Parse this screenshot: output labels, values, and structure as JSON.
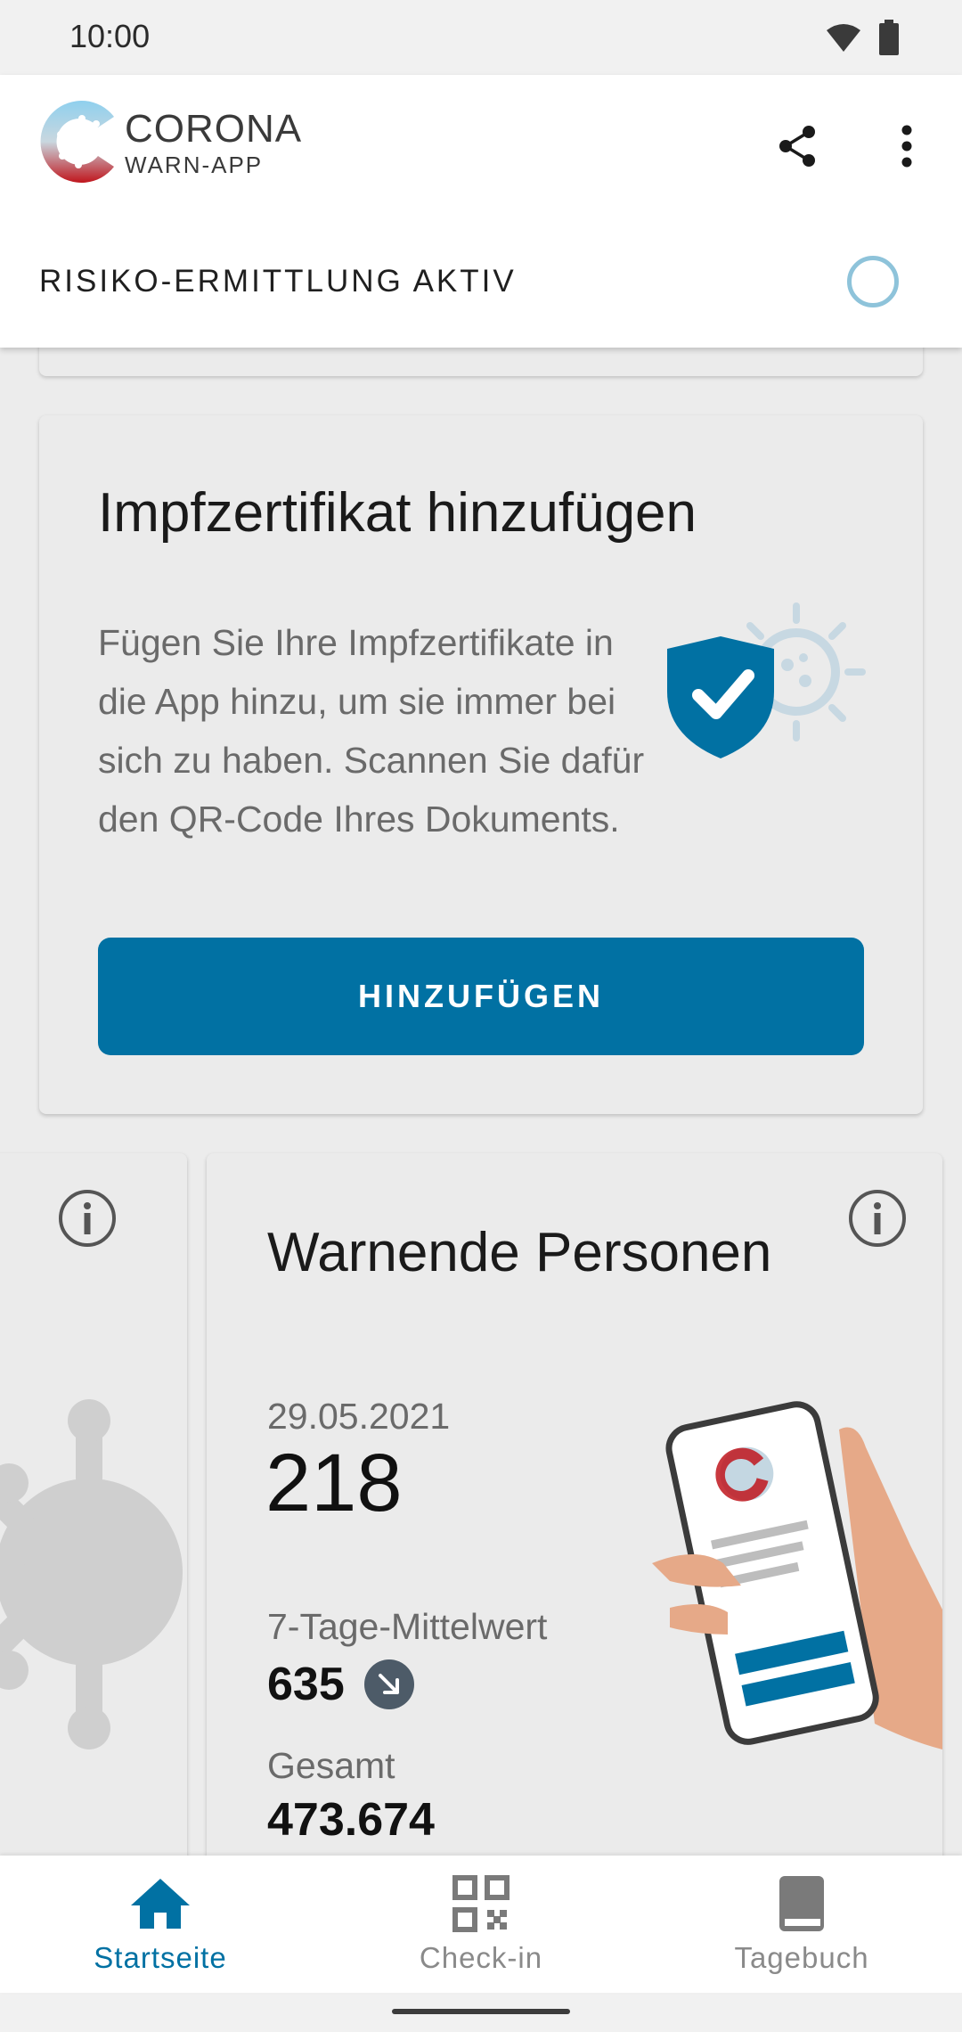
{
  "status_bar": {
    "time": "10:00"
  },
  "header": {
    "logo_line1": "CORONA",
    "logo_line2": "WARN-APP",
    "risk_status": "RISIKO-ERMITTLUNG AKTIV"
  },
  "cert_card": {
    "title": "Impfzertifikat hinzufügen",
    "body": "Fügen Sie Ihre Impfzertifikate in die App hinzu, um sie immer bei sich zu haben. Scannen Sie dafür den QR-Code Ihres Dokuments.",
    "button_label": "HINZUFÜGEN"
  },
  "warn_card": {
    "title": "Warnende Personen",
    "date": "29.05.2021",
    "value": "218",
    "avg_label": "7-Tage-Mittelwert",
    "avg_value": "635",
    "avg_trend": "trend-down-icon",
    "total_label": "Gesamt",
    "total_value": "473.674"
  },
  "bottom_nav": {
    "items": [
      {
        "label": "Startseite",
        "icon": "home-icon",
        "active": true
      },
      {
        "label": "Check-in",
        "icon": "qr-code-icon",
        "active": false
      },
      {
        "label": "Tagebuch",
        "icon": "book-icon",
        "active": false
      }
    ]
  },
  "colors": {
    "primary": "#0171a3",
    "spinner": "#8ec3da",
    "trend_badge": "#4d5b68"
  }
}
